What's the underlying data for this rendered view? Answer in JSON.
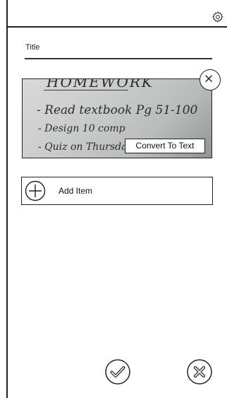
{
  "header": {
    "settings_icon": "gear-icon"
  },
  "form": {
    "title_label": "Title"
  },
  "attachment": {
    "handwriting": {
      "line1": "HOMEWORK",
      "line2": "- Read textbook Pg 51-100",
      "line3": "- Design 10 comp",
      "line4": "- Quiz on Thursday"
    },
    "remove_icon": "close-circle-icon",
    "convert_label": "Convert To Text"
  },
  "add_item": {
    "label": "Add Item",
    "icon": "plus-circle-icon"
  },
  "footer": {
    "confirm_icon": "check-circle-icon",
    "cancel_icon": "x-circle-icon"
  }
}
